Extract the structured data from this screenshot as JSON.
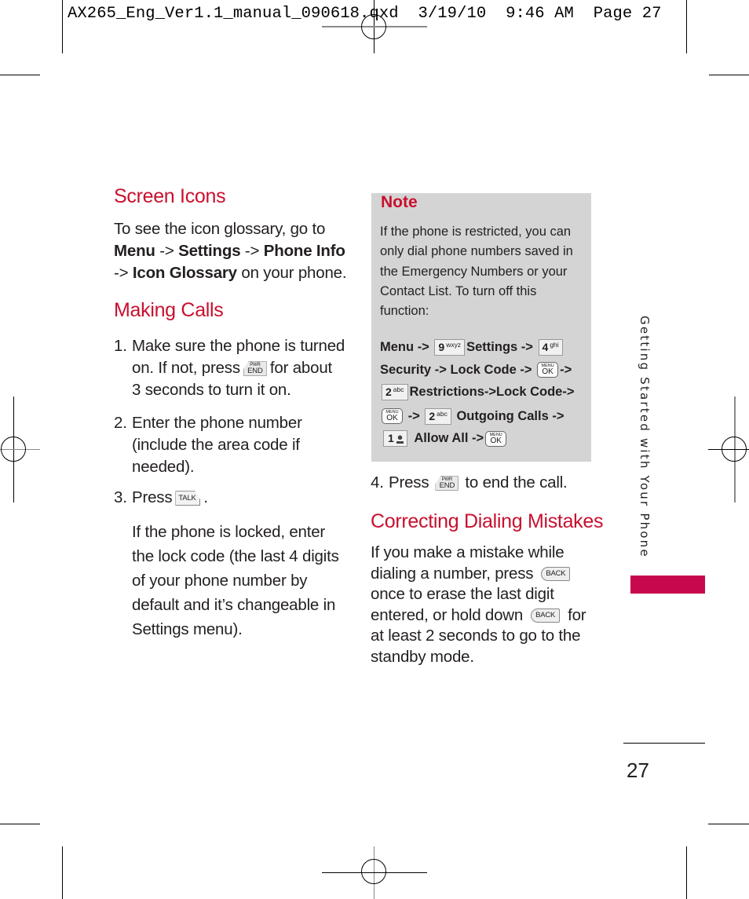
{
  "slug": {
    "text": "AX265_Eng_Ver1.1_manual_090618.qxd  3/19/10  9:46 AM  Page 27"
  },
  "screen_icons": {
    "title": "Screen Icons",
    "line1": "To see the icon glossary, go to",
    "path": [
      {
        "text": "Menu",
        "bold": true
      },
      {
        "text": " -> ",
        "bold": false
      },
      {
        "text": "Settings",
        "bold": true
      },
      {
        "text": " -> ",
        "bold": false
      },
      {
        "text": "Phone Info",
        "bold": true
      }
    ],
    "line3_prefix": "-> ",
    "line3_bold": "Icon Glossary",
    "line3_suffix": " on your phone."
  },
  "making_calls": {
    "title": "Making Calls",
    "step1": {
      "num": "1.",
      "line1": "Make sure the phone is turned",
      "line2_a": "on. If not, press",
      "line2_b": "for about",
      "line3": "3 seconds to turn it on."
    },
    "step2": {
      "num": "2.",
      "line1": "Enter the phone number",
      "line2": "(include the area code if",
      "line3": "needed)."
    },
    "step3": {
      "num": "3.",
      "text_a": "Press",
      "text_b": "."
    },
    "locked_para": [
      "If the phone is locked, enter",
      "the lock code (the last 4 digits",
      "of your phone number by",
      "default and it’s changeable in",
      "Settings menu)."
    ],
    "step4": {
      "num": "4.",
      "text_a": "Press",
      "text_b": "to end the call."
    }
  },
  "note": {
    "title": "Note",
    "text": "If the phone is restricted, you can only dial phone numbers saved in the Emergency Numbers or your Contact List. To turn off this function:",
    "steps": {
      "menu": "Menu",
      "arrow": "->",
      "settings": "Settings",
      "security": "Security",
      "lock_code": "Lock Code",
      "restrictions_lock": "Restrictions->Lock Code->",
      "outgoing_calls": "Outgoing Calls",
      "allow_all": "Allow All"
    }
  },
  "correcting": {
    "title": "Correcting Dialing Mistakes",
    "line1": "If you make a mistake while",
    "line2_a": "dialing a number, press",
    "line3": "once to erase the last digit",
    "line4_a": "entered, or hold down",
    "line4_b": "for",
    "line5": "at least 2 seconds to go to the",
    "line6": "standby mode."
  },
  "keys": {
    "nine": {
      "digit": "9",
      "letters": "wxyz"
    },
    "four": {
      "digit": "4",
      "letters": "ghi"
    },
    "two": {
      "digit": "2",
      "letters": "abc"
    },
    "one": {
      "digit": "1"
    },
    "ok": {
      "top": "MENU",
      "main": "OK"
    },
    "end": {
      "top": "PWR",
      "main": "END"
    },
    "talk": {
      "main": "TALK"
    },
    "back": {
      "main": "BACK"
    }
  },
  "sidebar": {
    "label": "Getting Started with Your Phone",
    "tab_color": "#c8084c"
  },
  "page_number": "27",
  "colors": {
    "heading": "#c8102e",
    "note_bg": "#d4d4d4",
    "text": "#231f20"
  }
}
